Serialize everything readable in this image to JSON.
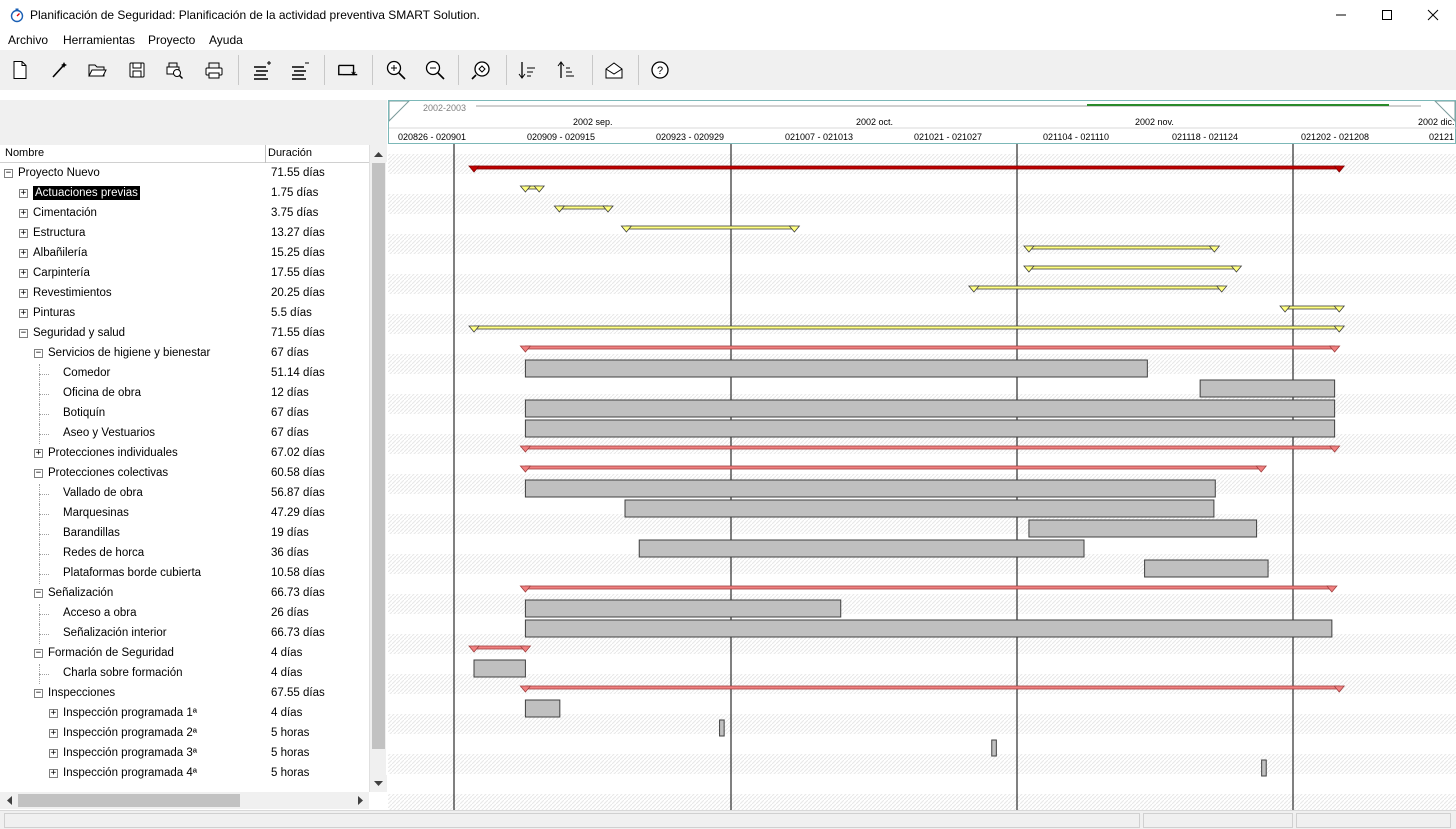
{
  "window": {
    "title": "Planificación de Seguridad: Planificación de la actividad preventiva SMART Solution."
  },
  "menu": [
    "Archivo",
    "Herramientas",
    "Proyecto",
    "Ayuda"
  ],
  "toolbar": {
    "icons": [
      "new-document-icon",
      "wizard-icon",
      "open-folder-icon",
      "save-icon",
      "print-preview-icon",
      "print-icon",
      "indent-icon",
      "outdent-icon",
      "link-tasks-icon",
      "zoom-in-icon",
      "zoom-out-icon",
      "zoom-fit-icon",
      "sort-ascending-icon",
      "sort-descending-icon",
      "send-mail-icon",
      "help-icon"
    ]
  },
  "tree": {
    "columns": [
      "Nombre",
      "Duración"
    ],
    "rows": [
      {
        "name": "Proyecto Nuevo",
        "duration": "71.55 días",
        "level": 0,
        "expander": "minus"
      },
      {
        "name": "Actuaciones previas",
        "duration": "1.75 días",
        "level": 1,
        "expander": "plus",
        "selected": true
      },
      {
        "name": "Cimentación",
        "duration": "3.75 días",
        "level": 1,
        "expander": "plus"
      },
      {
        "name": "Estructura",
        "duration": "13.27 días",
        "level": 1,
        "expander": "plus"
      },
      {
        "name": "Albañilería",
        "duration": "15.25 días",
        "level": 1,
        "expander": "plus"
      },
      {
        "name": "Carpintería",
        "duration": "17.55 días",
        "level": 1,
        "expander": "plus"
      },
      {
        "name": "Revestimientos",
        "duration": "20.25 días",
        "level": 1,
        "expander": "plus"
      },
      {
        "name": "Pinturas",
        "duration": "5.5 días",
        "level": 1,
        "expander": "plus"
      },
      {
        "name": "Seguridad y salud",
        "duration": "71.55 días",
        "level": 1,
        "expander": "minus"
      },
      {
        "name": "Servicios de higiene y bienestar",
        "duration": "67 días",
        "level": 2,
        "expander": "minus"
      },
      {
        "name": "Comedor",
        "duration": "51.14 días",
        "level": 3,
        "expander": "none"
      },
      {
        "name": "Oficina de obra",
        "duration": "12 días",
        "level": 3,
        "expander": "none"
      },
      {
        "name": "Botiquín",
        "duration": "67 días",
        "level": 3,
        "expander": "none"
      },
      {
        "name": "Aseo y Vestuarios",
        "duration": "67 días",
        "level": 3,
        "expander": "none"
      },
      {
        "name": "Protecciones individuales",
        "duration": "67.02 días",
        "level": 2,
        "expander": "plus"
      },
      {
        "name": "Protecciones colectivas",
        "duration": "60.58 días",
        "level": 2,
        "expander": "minus"
      },
      {
        "name": "Vallado de obra",
        "duration": "56.87 días",
        "level": 3,
        "expander": "none"
      },
      {
        "name": "Marquesinas",
        "duration": "47.29 días",
        "level": 3,
        "expander": "none"
      },
      {
        "name": "Barandillas",
        "duration": "19 días",
        "level": 3,
        "expander": "none"
      },
      {
        "name": "Redes de horca",
        "duration": "36 días",
        "level": 3,
        "expander": "none"
      },
      {
        "name": "Plataformas borde cubierta",
        "duration": "10.58 días",
        "level": 3,
        "expander": "none"
      },
      {
        "name": "Señalización",
        "duration": "66.73 días",
        "level": 2,
        "expander": "minus"
      },
      {
        "name": "Acceso a obra",
        "duration": "26 días",
        "level": 3,
        "expander": "none"
      },
      {
        "name": "Señalización interior",
        "duration": "66.73 días",
        "level": 3,
        "expander": "none"
      },
      {
        "name": "Formación de Seguridad",
        "duration": "4 días",
        "level": 2,
        "expander": "minus"
      },
      {
        "name": "Charla sobre formación",
        "duration": "4 días",
        "level": 3,
        "expander": "none"
      },
      {
        "name": "Inspecciones",
        "duration": "67.55 días",
        "level": 2,
        "expander": "minus"
      },
      {
        "name": "Inspección programada 1ª",
        "duration": "4 días",
        "level": 3,
        "expander": "plus"
      },
      {
        "name": "Inspección programada 2ª",
        "duration": "5 horas",
        "level": 3,
        "expander": "plus"
      },
      {
        "name": "Inspección programada 3ª",
        "duration": "5 horas",
        "level": 3,
        "expander": "plus"
      },
      {
        "name": "Inspección programada 4ª",
        "duration": "5 horas",
        "level": 3,
        "expander": "plus"
      }
    ]
  },
  "timescale": {
    "year": "2002-2003",
    "months": [
      "2002 sep.",
      "2002 oct.",
      "2002 nov.",
      "2002 dic."
    ],
    "weeks": [
      "020826 - 020901",
      "020909 - 020915",
      "020923 - 020929",
      "021007 - 021013",
      "021021 - 021027",
      "021104 - 021110",
      "021118 - 021124",
      "021202 - 021208",
      "02121"
    ]
  },
  "gantt": {
    "colors": {
      "project": "#c00000",
      "yellow": "#ffff80",
      "summary_pink": "#f08080",
      "task_bar": "#c0c0c0"
    },
    "bars": [
      {
        "type": "project",
        "start": 0.0,
        "end": 0.9425
      },
      {
        "type": "yellow",
        "start": 0.056,
        "end": 0.071
      },
      {
        "type": "yellow",
        "start": 0.093,
        "end": 0.146
      },
      {
        "type": "yellow",
        "start": 0.166,
        "end": 0.349
      },
      {
        "type": "yellow",
        "start": 0.6045,
        "end": 0.8065
      },
      {
        "type": "yellow",
        "start": 0.6045,
        "end": 0.8305
      },
      {
        "type": "yellow",
        "start": 0.5445,
        "end": 0.8145
      },
      {
        "type": "yellow",
        "start": 0.8835,
        "end": 0.9425
      },
      {
        "type": "yellow",
        "start": 0.0,
        "end": 0.9425
      },
      {
        "type": "pink",
        "start": 0.056,
        "end": 0.9375
      },
      {
        "type": "task",
        "start": 0.056,
        "end": 0.7335
      },
      {
        "type": "task",
        "start": 0.791,
        "end": 0.9375
      },
      {
        "type": "task",
        "start": 0.056,
        "end": 0.9375
      },
      {
        "type": "task",
        "start": 0.056,
        "end": 0.9375
      },
      {
        "type": "pink",
        "start": 0.056,
        "end": 0.9375
      },
      {
        "type": "pink",
        "start": 0.056,
        "end": 0.8575
      },
      {
        "type": "task",
        "start": 0.056,
        "end": 0.8075
      },
      {
        "type": "task",
        "start": 0.1645,
        "end": 0.806
      },
      {
        "type": "task",
        "start": 0.6045,
        "end": 0.8525
      },
      {
        "type": "task",
        "start": 0.18,
        "end": 0.6645
      },
      {
        "type": "task",
        "start": 0.7305,
        "end": 0.865
      },
      {
        "type": "pink",
        "start": 0.056,
        "end": 0.9345
      },
      {
        "type": "task",
        "start": 0.056,
        "end": 0.3995
      },
      {
        "type": "task",
        "start": 0.056,
        "end": 0.9345
      },
      {
        "type": "pink",
        "start": 0.0,
        "end": 0.056
      },
      {
        "type": "task",
        "start": 0.0,
        "end": 0.056
      },
      {
        "type": "pink",
        "start": 0.056,
        "end": 0.9425
      },
      {
        "type": "task",
        "start": 0.056,
        "end": 0.0935
      },
      {
        "type": "task",
        "start": 0.2675,
        "end": 0.2725
      },
      {
        "type": "task",
        "start": 0.564,
        "end": 0.569
      },
      {
        "type": "task",
        "start": 0.858,
        "end": 0.863
      }
    ]
  }
}
